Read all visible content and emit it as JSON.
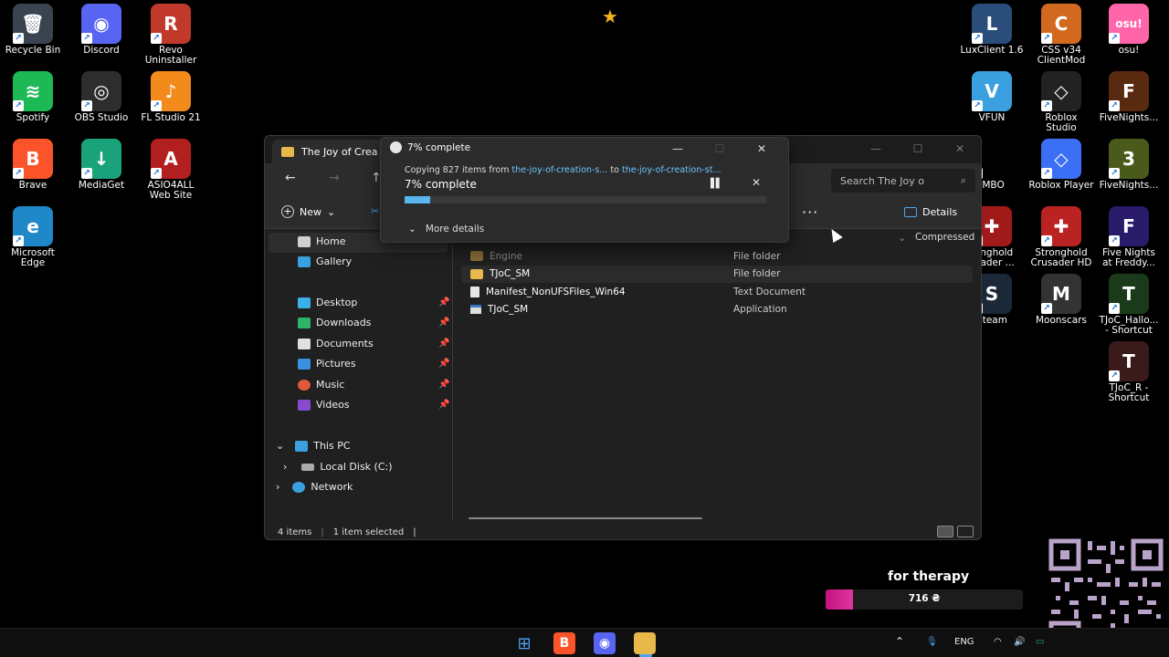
{
  "desktop_left": [
    {
      "label": "Recycle Bin",
      "icon": "recycle-bin-icon",
      "color": "#3a4450",
      "glyph": "🗑"
    },
    {
      "label": "Discord",
      "icon": "discord-icon",
      "color": "#5865f2",
      "glyph": "◉"
    },
    {
      "label": "Revo\nUninstaller",
      "icon": "revo-uninstaller-icon",
      "color": "#c0392b",
      "glyph": "R"
    },
    {
      "label": "Spotify",
      "icon": "spotify-icon",
      "color": "#1db954",
      "glyph": "≋"
    },
    {
      "label": "OBS Studio",
      "icon": "obs-studio-icon",
      "color": "#2d2d2d",
      "glyph": "◎"
    },
    {
      "label": "FL Studio 21",
      "icon": "fl-studio-icon",
      "color": "#f28a1c",
      "glyph": "♪"
    },
    {
      "label": "Brave",
      "icon": "brave-icon",
      "color": "#fb542b",
      "glyph": "B"
    },
    {
      "label": "MediaGet",
      "icon": "mediaget-icon",
      "color": "#1aa27a",
      "glyph": "↓"
    },
    {
      "label": "ASIO4ALL\nWeb Site",
      "icon": "asio4all-icon",
      "color": "#b21f1f",
      "glyph": "A"
    },
    {
      "label": "Microsoft\nEdge",
      "icon": "edge-icon",
      "color": "#1e88c9",
      "glyph": "e"
    }
  ],
  "desktop_right": [
    {
      "label": "LuxClient 1.6",
      "icon": "luxclient-icon",
      "color": "#2a4d7a",
      "glyph": "L"
    },
    {
      "label": "CSS v34\nClientMod",
      "icon": "css-icon",
      "color": "#d2691e",
      "glyph": "C"
    },
    {
      "label": "osu!",
      "icon": "osu-icon",
      "color": "#ff66aa",
      "glyph": "osu!"
    },
    {
      "label": "VFUN",
      "icon": "vfun-icon",
      "color": "#3aa0e0",
      "glyph": "V"
    },
    {
      "label": "Roblox\nStudio",
      "icon": "roblox-studio-icon",
      "color": "#222",
      "glyph": "◇"
    },
    {
      "label": "FiveNights...",
      "icon": "fnaf-icon",
      "color": "#5a2a10",
      "glyph": "F"
    },
    {
      "label": "IMBO",
      "icon": "imbo-icon",
      "color": "#000",
      "glyph": ""
    },
    {
      "label": "Roblox Player",
      "icon": "roblox-player-icon",
      "color": "#3b6ff5",
      "glyph": "◇"
    },
    {
      "label": "FiveNights...",
      "icon": "fnaf3-icon",
      "color": "#4a5a1a",
      "glyph": "3"
    },
    {
      "label": "ronghold\nusader ...",
      "icon": "stronghold-crusader-icon",
      "color": "#a01a1a",
      "glyph": "✚"
    },
    {
      "label": "Stronghold\nCrusader HD",
      "icon": "stronghold-crusader-hd-icon",
      "color": "#b22",
      "glyph": "✚"
    },
    {
      "label": "Five Nights\nat Freddy...",
      "icon": "fnaf-sl-icon",
      "color": "#2a1a6a",
      "glyph": "F"
    },
    {
      "label": "Steam",
      "icon": "steam-icon",
      "color": "#1b2838",
      "glyph": "S"
    },
    {
      "label": "Moonscars",
      "icon": "moonscars-icon",
      "color": "#333",
      "glyph": "M"
    },
    {
      "label": "TJoC_Hallo...\n- Shortcut",
      "icon": "tjoc-halloween-icon",
      "color": "#1a3a1a",
      "glyph": "T"
    },
    {
      "label": "TJoC_R -\nShortcut",
      "icon": "tjoc-r-icon",
      "color": "#3a1a1a",
      "glyph": "T"
    }
  ],
  "explorer": {
    "tab_title": "The Joy of Crea",
    "search_placeholder": "Search The Joy o",
    "new_label": "New",
    "details_label": "Details",
    "more_label": "···",
    "column_compressed": "Compressed",
    "sidebar": {
      "home": "Home",
      "gallery": "Gallery",
      "desktop": "Desktop",
      "downloads": "Downloads",
      "documents": "Documents",
      "pictures": "Pictures",
      "music": "Music",
      "videos": "Videos",
      "this_pc": "This PC",
      "local_disk": "Local Disk (C:)",
      "network": "Network"
    },
    "files": [
      {
        "name": "Engine",
        "type": "File folder"
      },
      {
        "name": "TJoC_SM",
        "type": "File folder"
      },
      {
        "name": "Manifest_NonUFSFiles_Win64",
        "type": "Text Document"
      },
      {
        "name": "TJoC_SM",
        "type": "Application"
      }
    ],
    "status_items": "4 items",
    "status_selected": "1 item selected"
  },
  "copy_dialog": {
    "title": "7% complete",
    "copying_prefix": "Copying 827 items from",
    "source": "the-joy-of-creation-s...",
    "to_word": "to",
    "destination": "the-joy-of-creation-st...",
    "percent_label": "7% complete",
    "progress": 0.07,
    "more_details": "More details"
  },
  "overlay": {
    "donation_title": "for therapy",
    "donation_amount": "716 ₴",
    "donation_progress": 0.14
  },
  "taskbar": {
    "language": "ENG"
  }
}
